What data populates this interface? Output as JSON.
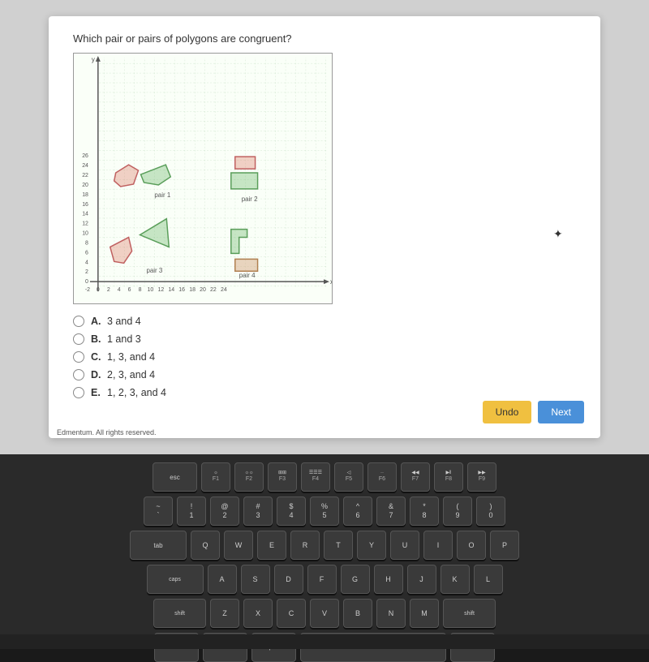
{
  "question": {
    "text": "Which pair or pairs of polygons are congruent?",
    "graph": {
      "xAxis": {
        "min": -2,
        "max": 24,
        "label": "x"
      },
      "yAxis": {
        "min": 0,
        "max": 26,
        "label": "y"
      },
      "pairs": [
        {
          "id": "pair1",
          "label": "pair 1"
        },
        {
          "id": "pair2",
          "label": "pair 2"
        },
        {
          "id": "pair3",
          "label": "pair 3"
        },
        {
          "id": "pair4",
          "label": "pair 4"
        }
      ]
    },
    "answers": [
      {
        "id": "A",
        "letter": "A.",
        "text": "3 and 4"
      },
      {
        "id": "B",
        "letter": "B.",
        "text": "1 and 3"
      },
      {
        "id": "C",
        "letter": "C.",
        "text": "1, 3, and 4"
      },
      {
        "id": "D",
        "letter": "D.",
        "text": "2, 3, and 4"
      },
      {
        "id": "E",
        "letter": "E.",
        "text": "1, 2, 3, and 4"
      }
    ]
  },
  "buttons": {
    "undo": "Undo",
    "next": "Next"
  },
  "footer": {
    "text": "Edmentum. All rights reserved."
  },
  "keyboard": {
    "row1": [
      "F1",
      "F2",
      "F3",
      "F4",
      "F5",
      "F6",
      "F7",
      "F8",
      "F9"
    ],
    "row2": [
      "@\n2",
      "#\n3",
      "$\n4",
      "%\n5",
      "^\n6",
      "&\n7",
      "*\n8",
      "(\n9"
    ],
    "row3": [
      "W",
      "E",
      "R",
      "T",
      "Y",
      "U",
      "I",
      "O",
      "P"
    ],
    "row4": [
      "A",
      "S",
      "D",
      "F",
      "G",
      "H",
      "J",
      "K",
      "L"
    ],
    "row5": [
      "Z",
      "X",
      "C",
      "V",
      "B",
      "N",
      "M"
    ]
  }
}
